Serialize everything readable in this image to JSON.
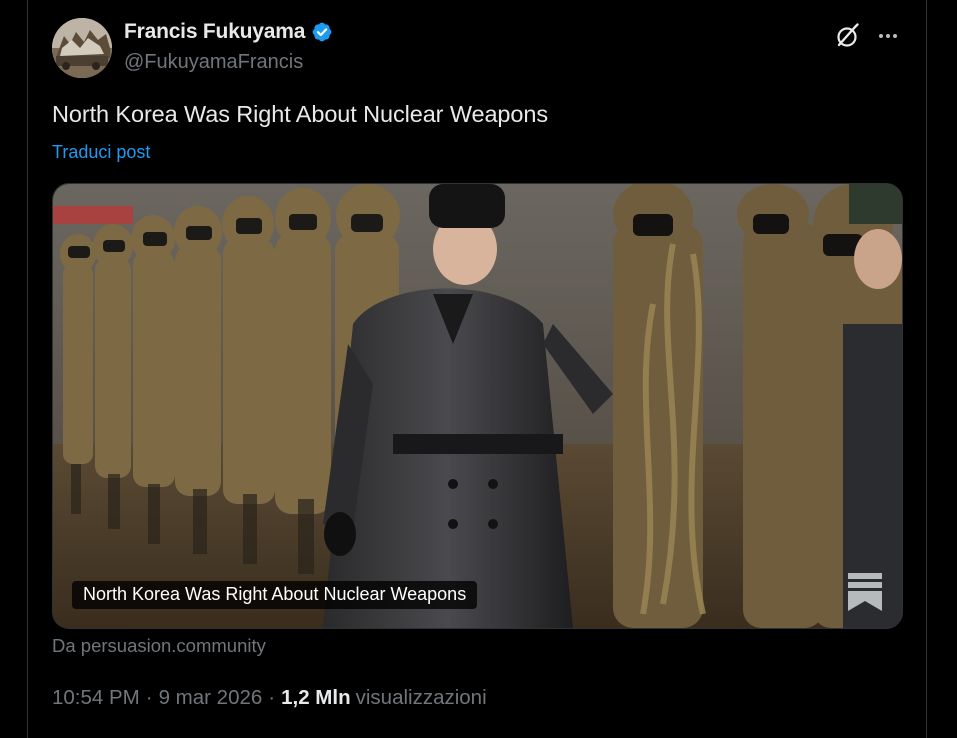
{
  "author": {
    "display_name": "Francis Fukuyama",
    "handle": "@FukuyamaFrancis",
    "verified": true
  },
  "tweet": {
    "text": "North Korea Was Right About Nuclear Weapons",
    "translate_label": "Traduci post"
  },
  "card": {
    "title": "North Korea Was Right About Nuclear Weapons",
    "source": "Da persuasion.community"
  },
  "meta": {
    "time": "10:54 PM",
    "date": "9 mar 2026",
    "separator": "·",
    "views_count": "1,2 Mln",
    "views_label": "visualizzazioni"
  },
  "icons": {
    "verified": "verified-badge-icon",
    "grok": "grok-icon",
    "more": "more-dots-icon",
    "publisher": "bookmark-logo-icon"
  },
  "colors": {
    "background": "#000000",
    "text_primary": "#e7e9ea",
    "text_secondary": "#71767b",
    "link": "#1d9bf0",
    "verified": "#1d9bf0",
    "border": "#2f3336"
  }
}
